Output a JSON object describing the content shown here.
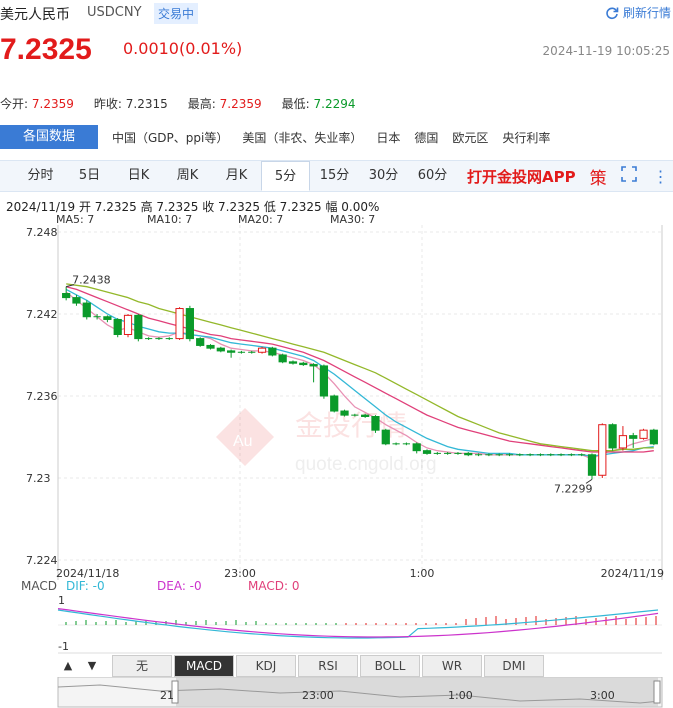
{
  "header": {
    "title": "美元人民币",
    "code": "USDCNY",
    "badge": "交易中",
    "refresh": "刷新行情",
    "price": "7.2325",
    "change": "0.0010(0.01%)",
    "time": "2024-11-19 10:05:25"
  },
  "stats": [
    {
      "label": "今开:",
      "value": "7.2359",
      "color": "#e21b1b"
    },
    {
      "label": "昨收:",
      "value": "7.2315",
      "color": "#333333"
    },
    {
      "label": "最高:",
      "value": "7.2359",
      "color": "#e21b1b"
    },
    {
      "label": "最低:",
      "value": "7.2294",
      "color": "#0a9a2a"
    }
  ],
  "tabs": {
    "active": "各国数据",
    "items": [
      "中国（GDP、ppi等）",
      "美国（非农、失业率）",
      "日本",
      "德国",
      "欧元区",
      "央行利率"
    ]
  },
  "periods": {
    "items": [
      "分时",
      "5日",
      "日K",
      "周K",
      "月K",
      "5分",
      "15分",
      "30分",
      "60分"
    ],
    "active": "5分",
    "app": "打开金投网APP",
    "pic_icon": "策"
  },
  "ohlc": "2024/11/19  开 7.2325  高 7.2325  收 7.2325  低 7.2325  幅 0.00%",
  "ma": [
    {
      "label": "MA5: 7",
      "color": "#e891b4"
    },
    {
      "label": "MA10: 7",
      "color": "#33b8d6"
    },
    {
      "label": "MA20: 7",
      "color": "#e0407a"
    },
    {
      "label": "MA30: 7",
      "color": "#93b82a"
    }
  ],
  "chart_data": {
    "type": "candlestick",
    "y_ticks": [
      "7.248",
      "7.242",
      "7.236",
      "7.23",
      "7.224"
    ],
    "ylim": [
      7.224,
      7.248
    ],
    "x_labels": [
      "2024/11/18",
      "23:00",
      "1:00",
      "2024/11/19"
    ],
    "annotations": {
      "high": "7.2438",
      "low": "7.2299"
    },
    "candles": [
      [
        7.2435,
        7.2432,
        7.244,
        7.243
      ],
      [
        7.2432,
        7.2428,
        7.2434,
        7.2426
      ],
      [
        7.2428,
        7.2418,
        7.243,
        7.2416
      ],
      [
        7.2418,
        7.2418,
        7.242,
        7.2416
      ],
      [
        7.2418,
        7.2416,
        7.2419,
        7.2414
      ],
      [
        7.2416,
        7.2405,
        7.2417,
        7.2403
      ],
      [
        7.2405,
        7.2419,
        7.242,
        7.2403
      ],
      [
        7.2419,
        7.2402,
        7.242,
        7.24
      ],
      [
        7.2402,
        7.2402,
        7.2403,
        7.2401
      ],
      [
        7.2402,
        7.2402,
        7.2403,
        7.2401
      ],
      [
        7.2402,
        7.2402,
        7.2403,
        7.2401
      ],
      [
        7.2402,
        7.2424,
        7.2425,
        7.2401
      ],
      [
        7.2424,
        7.2402,
        7.2426,
        7.24
      ],
      [
        7.2402,
        7.2397,
        7.2403,
        7.2396
      ],
      [
        7.2397,
        7.2395,
        7.2398,
        7.2394
      ],
      [
        7.2395,
        7.2393,
        7.2396,
        7.2392
      ],
      [
        7.2393,
        7.2392,
        7.2394,
        7.2388
      ],
      [
        7.2392,
        7.2392,
        7.2393,
        7.2391
      ],
      [
        7.2392,
        7.2392,
        7.2393,
        7.2391
      ],
      [
        7.2392,
        7.2395,
        7.2396,
        7.2391
      ],
      [
        7.2395,
        7.239,
        7.2396,
        7.2389
      ],
      [
        7.239,
        7.2385,
        7.2391,
        7.2384
      ],
      [
        7.2385,
        7.2384,
        7.2386,
        7.2383
      ],
      [
        7.2384,
        7.2383,
        7.2385,
        7.2382
      ],
      [
        7.2383,
        7.2382,
        7.2384,
        7.237
      ],
      [
        7.2382,
        7.236,
        7.2383,
        7.2358
      ],
      [
        7.236,
        7.2349,
        7.2361,
        7.2348
      ],
      [
        7.2349,
        7.2346,
        7.235,
        7.2345
      ],
      [
        7.2346,
        7.2346,
        7.2347,
        7.2345
      ],
      [
        7.2346,
        7.2345,
        7.2347,
        7.2344
      ],
      [
        7.2345,
        7.2335,
        7.2346,
        7.2333
      ],
      [
        7.2335,
        7.2325,
        7.2336,
        7.2324
      ],
      [
        7.2325,
        7.2325,
        7.2326,
        7.2324
      ],
      [
        7.2325,
        7.2325,
        7.2326,
        7.2324
      ],
      [
        7.2325,
        7.232,
        7.2326,
        7.2318
      ],
      [
        7.232,
        7.2318,
        7.2321,
        7.2317
      ],
      [
        7.2318,
        7.2318,
        7.2319,
        7.2317
      ],
      [
        7.2318,
        7.2318,
        7.2319,
        7.2317
      ],
      [
        7.2318,
        7.2318,
        7.2319,
        7.2317
      ],
      [
        7.2318,
        7.2317,
        7.2319,
        7.2316
      ],
      [
        7.2317,
        7.2317,
        7.2318,
        7.2316
      ],
      [
        7.2317,
        7.2317,
        7.2318,
        7.2316
      ],
      [
        7.2317,
        7.2317,
        7.2318,
        7.2316
      ],
      [
        7.2317,
        7.2317,
        7.2318,
        7.2316
      ],
      [
        7.2317,
        7.2317,
        7.2318,
        7.2316
      ],
      [
        7.2317,
        7.2317,
        7.2318,
        7.2316
      ],
      [
        7.2317,
        7.2317,
        7.2318,
        7.2316
      ],
      [
        7.2317,
        7.2317,
        7.2318,
        7.2316
      ],
      [
        7.2317,
        7.2317,
        7.2318,
        7.2316
      ],
      [
        7.2317,
        7.2317,
        7.2318,
        7.2316
      ],
      [
        7.2317,
        7.2317,
        7.2318,
        7.2316
      ],
      [
        7.2317,
        7.2302,
        7.2318,
        7.2299
      ],
      [
        7.2302,
        7.2339,
        7.234,
        7.23
      ],
      [
        7.2339,
        7.2322,
        7.234,
        7.232
      ],
      [
        7.2322,
        7.2331,
        7.2338,
        7.232
      ],
      [
        7.2331,
        7.2329,
        7.2333,
        7.2322
      ],
      [
        7.2329,
        7.2335,
        7.2336,
        7.2328
      ],
      [
        7.2335,
        7.2325,
        7.2336,
        7.2324
      ]
    ],
    "ma_lines": [
      {
        "name": "MA5",
        "color": "#e891b4",
        "values": [
          7.2436,
          7.243,
          7.2424,
          7.2418,
          7.2412,
          7.2408,
          7.241,
          7.2407,
          7.2404,
          7.2403,
          7.2404,
          7.2407,
          7.2405,
          7.2404,
          7.2402,
          7.2398,
          7.2395,
          7.2394,
          7.2393,
          7.2393,
          7.2392,
          7.239,
          7.2388,
          7.2386,
          7.2383,
          7.2377,
          7.2369,
          7.236,
          7.2352,
          7.2348,
          7.2344,
          7.2339,
          7.2335,
          7.2331,
          7.2326,
          7.2322,
          7.232,
          7.2319,
          7.2318,
          7.2318,
          7.2318,
          7.2317,
          7.2317,
          7.2317,
          7.2317,
          7.2317,
          7.2317,
          7.2317,
          7.2317,
          7.2317,
          7.2317,
          7.2314,
          7.2318,
          7.232,
          7.2322,
          7.2325,
          7.2327,
          7.2329
        ]
      },
      {
        "name": "MA10",
        "color": "#33b8d6",
        "values": [
          7.2438,
          7.2434,
          7.243,
          7.2425,
          7.242,
          7.2416,
          7.2414,
          7.2411,
          7.2409,
          7.2407,
          7.2406,
          7.2406,
          7.2405,
          7.2404,
          7.2403,
          7.2401,
          7.2399,
          7.2398,
          7.2397,
          7.2396,
          7.2395,
          7.2393,
          7.2391,
          7.2389,
          7.2386,
          7.2381,
          7.2376,
          7.237,
          7.2364,
          7.2358,
          7.2352,
          7.2346,
          7.2341,
          7.2337,
          7.2333,
          7.2329,
          7.2326,
          7.2323,
          7.2321,
          7.232,
          7.2319,
          7.2318,
          7.2318,
          7.2318,
          7.2317,
          7.2317,
          7.2317,
          7.2317,
          7.2317,
          7.2317,
          7.2317,
          7.2316,
          7.2317,
          7.2318,
          7.2319,
          7.232,
          7.2322,
          7.2323
        ]
      },
      {
        "name": "MA20",
        "color": "#e0407a",
        "values": [
          7.244,
          7.2438,
          7.2435,
          7.2432,
          7.2429,
          7.2426,
          7.2423,
          7.242,
          7.2417,
          7.2415,
          7.2413,
          7.2411,
          7.2409,
          7.2407,
          7.2405,
          7.2404,
          7.2402,
          7.2401,
          7.24,
          7.2399,
          7.2398,
          7.2396,
          7.2394,
          7.2392,
          7.2389,
          7.2386,
          7.2382,
          7.2378,
          7.2374,
          7.237,
          7.2366,
          7.2362,
          7.2358,
          7.2354,
          7.235,
          7.2346,
          7.2343,
          7.234,
          7.2337,
          7.2335,
          7.2333,
          7.2331,
          7.2329,
          7.2327,
          7.2326,
          7.2325,
          7.2324,
          7.2323,
          7.2322,
          7.2321,
          7.232,
          7.2319,
          7.2319,
          7.2319,
          7.2319,
          7.2319,
          7.2319,
          7.232
        ]
      },
      {
        "name": "MA30",
        "color": "#93b82a",
        "values": [
          7.2442,
          7.2441,
          7.244,
          7.2438,
          7.2436,
          7.2434,
          7.2432,
          7.2429,
          7.2427,
          7.2424,
          7.2422,
          7.242,
          7.2418,
          7.2416,
          7.2414,
          7.2412,
          7.241,
          7.2408,
          7.2406,
          7.2404,
          7.2402,
          7.24,
          7.2398,
          7.2396,
          7.2394,
          7.2392,
          7.2389,
          7.2386,
          7.2383,
          7.238,
          7.2377,
          7.2373,
          7.2369,
          7.2365,
          7.2361,
          7.2357,
          7.2353,
          7.2349,
          7.2345,
          7.2342,
          7.2339,
          7.2336,
          7.2333,
          7.2331,
          7.2329,
          7.2327,
          7.2325,
          7.2324,
          7.2323,
          7.2322,
          7.2321,
          7.232,
          7.232,
          7.232,
          7.2321,
          7.2321,
          7.2322,
          7.2322
        ]
      }
    ]
  },
  "macd": {
    "label": "MACD",
    "dif": "DIF: -0",
    "dea": "DEA: -0",
    "macd": "MACD: 0",
    "y_top": "1",
    "y_bottom": "-1"
  },
  "bottom_tabs": [
    "无",
    "MACD",
    "KDJ",
    "RSI",
    "BOLL",
    "WR",
    "DMI"
  ],
  "bottom_active": "MACD",
  "nav_labels": [
    "21",
    "23:00",
    "1:00",
    "3:00"
  ],
  "colors": {
    "up": "#e21b1b",
    "down": "#0a9a2a",
    "accent": "#3a7bd5"
  }
}
